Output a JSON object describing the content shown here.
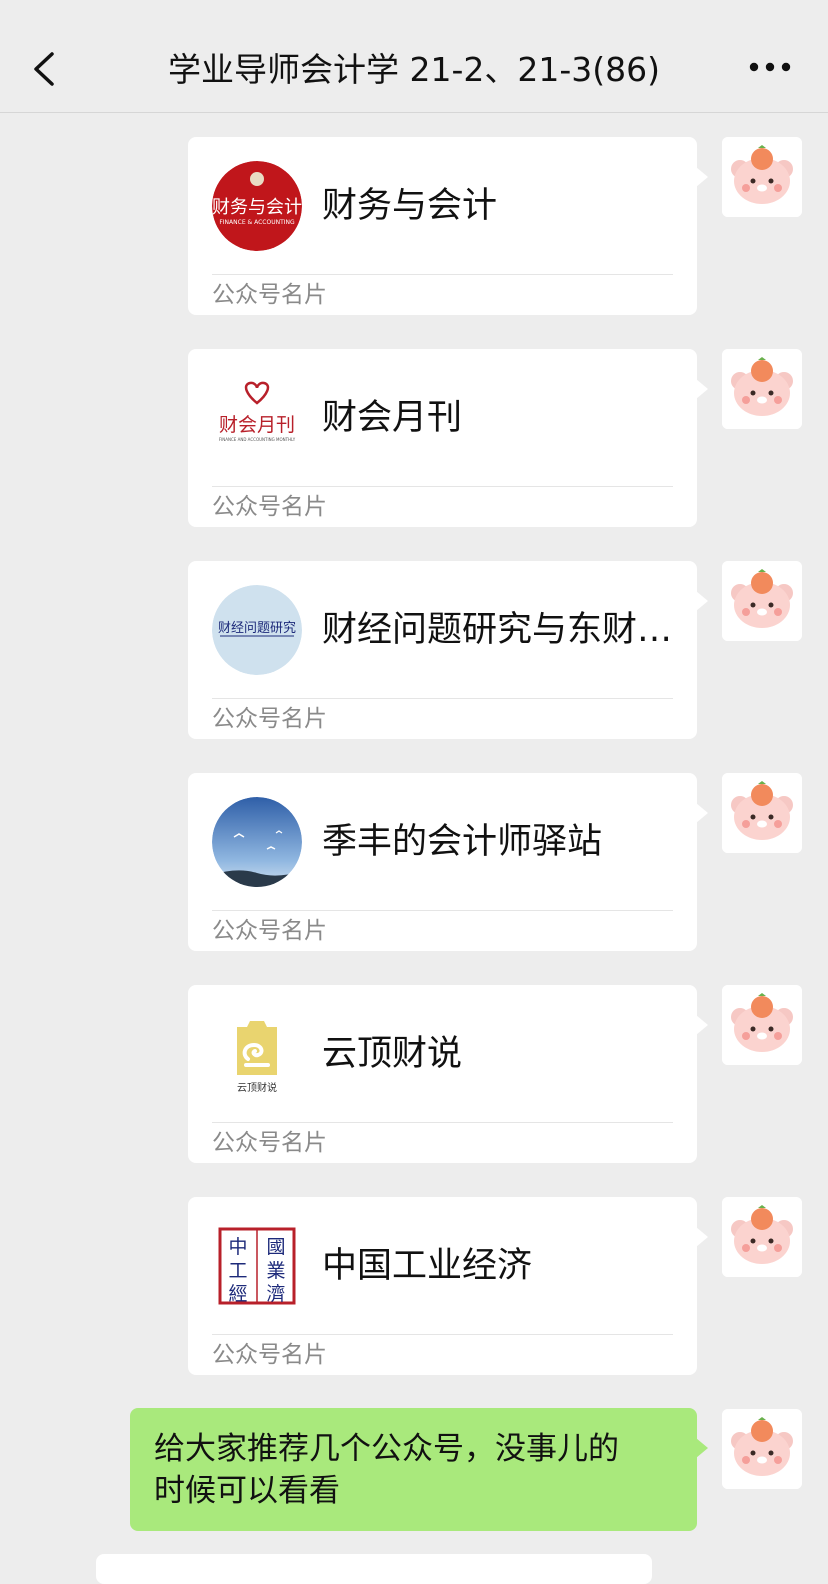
{
  "header": {
    "title": "学业导师会计学 21-2、21-3(86)"
  },
  "messages": [
    {
      "type": "card",
      "name": "财务与会计",
      "card_type": "公众号名片",
      "logo_text": "财务与会计",
      "logo_sub": "FINANCE & ACCOUNTING"
    },
    {
      "type": "card",
      "name": "财会月刊",
      "card_type": "公众号名片",
      "logo_text": "财会月刊",
      "logo_sub": "FINANCE AND ACCOUNTING MONTHLY"
    },
    {
      "type": "card",
      "name": "财经问题研究与东财…",
      "card_type": "公众号名片",
      "logo_text": "财经问题研究"
    },
    {
      "type": "card",
      "name": "季丰的会计师驿站",
      "card_type": "公众号名片"
    },
    {
      "type": "card",
      "name": "云顶财说",
      "card_type": "公众号名片",
      "logo_text": "云顶财说"
    },
    {
      "type": "card",
      "name": "中国工业经济",
      "card_type": "公众号名片",
      "logo_chars": [
        "中",
        "國",
        "工",
        "業",
        "經",
        "濟"
      ]
    },
    {
      "type": "text",
      "text_line1": "给大家推荐几个公众号，没事儿的",
      "text_line2": "时候可以看看"
    }
  ],
  "colors": {
    "background": "#ededed",
    "bubble_green": "#a9e97c",
    "card_white": "#ffffff"
  }
}
